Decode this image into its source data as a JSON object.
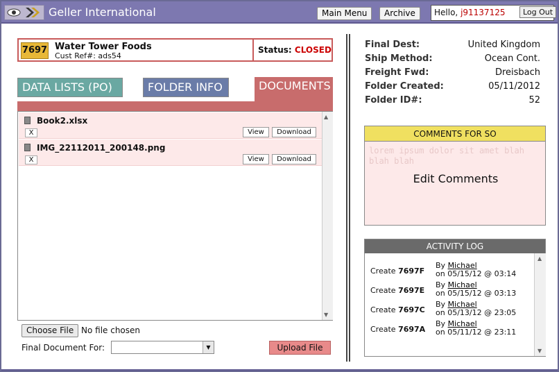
{
  "header": {
    "title": "Geller International",
    "main_menu": "Main Menu",
    "archive": "Archive",
    "hello": "Hello,",
    "user": "j91137125",
    "logout": "Log Out"
  },
  "folder": {
    "number": "7697",
    "client": "Water Tower Foods",
    "custref": "Cust Ref#: ads54",
    "status_label": "Status:",
    "status_value": "CLOSED"
  },
  "tabs": {
    "data_lists": "DATA LISTS (PO)",
    "folder_info": "FOLDER INFO",
    "documents": "DOCUMENTS"
  },
  "documents": [
    {
      "name": "Book2.xlsx",
      "remove": "X",
      "view": "View",
      "download": "Download"
    },
    {
      "name": "IMG_22112011_200148.png",
      "remove": "X",
      "view": "View",
      "download": "Download"
    }
  ],
  "upload": {
    "choose": "Choose File",
    "no_file": "No file chosen",
    "final_doc_label": "Final Document For:",
    "final_doc_value": "",
    "upload_label": "Upload File"
  },
  "details": [
    {
      "label": "Final Dest:",
      "value": "United Kingdom"
    },
    {
      "label": "Ship Method:",
      "value": "Ocean Cont."
    },
    {
      "label": "Freight Fwd:",
      "value": "Dreisbach"
    },
    {
      "label": "Folder Created:",
      "value": "05/11/2012"
    },
    {
      "label": "Folder ID#:",
      "value": "52"
    }
  ],
  "comments": {
    "title": "COMMENTS FOR SO",
    "placeholder": "lorem ipsum dolor sit amet blah blah blah",
    "edit": "Edit Comments"
  },
  "activity": {
    "title": "ACTIVITY LOG",
    "items": [
      {
        "action": "Create",
        "id": "7697F",
        "by": "By",
        "user": "Michael",
        "on": "on 05/15/12 @ 03:14"
      },
      {
        "action": "Create",
        "id": "7697E",
        "by": "By",
        "user": "Michael",
        "on": "on 05/15/12 @ 03:13"
      },
      {
        "action": "Create",
        "id": "7697C",
        "by": "By",
        "user": "Michael",
        "on": "on 05/13/12 @ 23:05"
      },
      {
        "action": "Create",
        "id": "7697A",
        "by": "By",
        "user": "Michael",
        "on": "on 05/11/12 @ 23:11"
      }
    ]
  },
  "colors": {
    "header": "#7d78b0",
    "documents_tab": "#c86c6c",
    "status": "#cc0000",
    "comments_head": "#f0e060"
  }
}
